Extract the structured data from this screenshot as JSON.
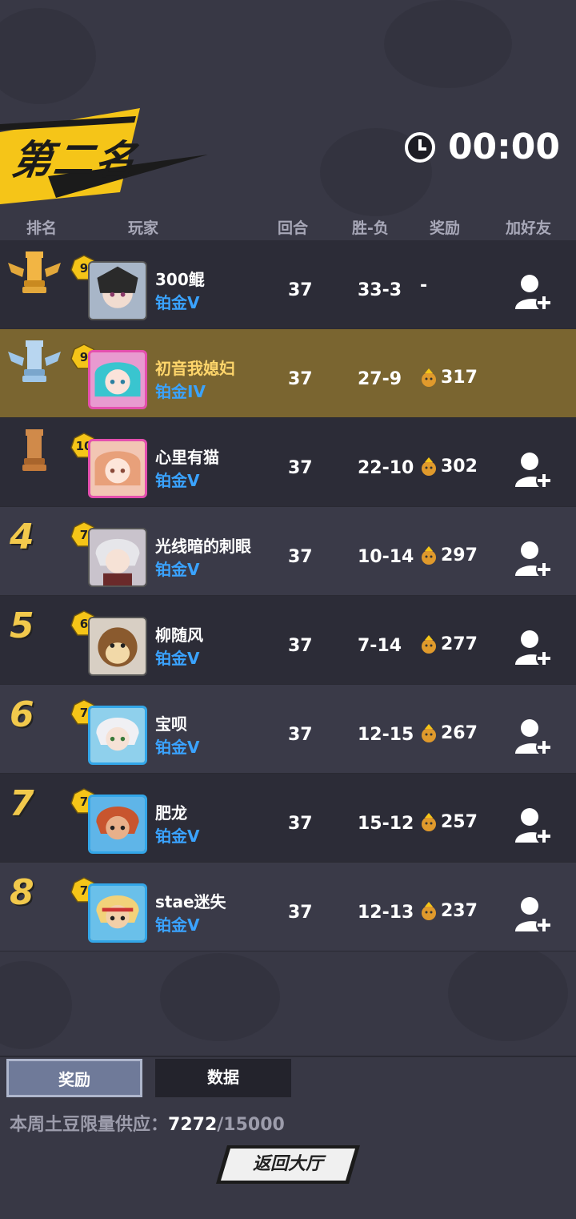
{
  "header": {
    "title": "第二名",
    "timer": "00:00",
    "colors": {
      "banner_yellow": "#f5c518",
      "self_row": "#7a6530",
      "tier_blue": "#3aa3ff"
    }
  },
  "columns": {
    "rank": "排名",
    "player": "玩家",
    "rounds": "回合",
    "win_loss": "胜-负",
    "reward": "奖励",
    "add_friend": "加好友"
  },
  "players": [
    {
      "rank": "1",
      "rank_icon": "gold-rook-icon",
      "level": "9",
      "name": "300鲲",
      "tier": "铂金V",
      "rounds": "37",
      "win_loss": "33-3",
      "reward": "-",
      "add_friend": true,
      "self": false
    },
    {
      "rank": "2",
      "rank_icon": "silver-rook-icon",
      "level": "9",
      "name": "初音我媳妇",
      "tier": "铂金IV",
      "rounds": "37",
      "win_loss": "27-9",
      "reward": "317",
      "add_friend": false,
      "self": true
    },
    {
      "rank": "3",
      "rank_icon": "bronze-rook-icon",
      "level": "10",
      "name": "心里有猫",
      "tier": "铂金V",
      "rounds": "37",
      "win_loss": "22-10",
      "reward": "302",
      "add_friend": true,
      "self": false
    },
    {
      "rank": "4",
      "level": "7",
      "name": "光线暗的刺眼",
      "tier": "铂金V",
      "rounds": "37",
      "win_loss": "10-14",
      "reward": "297",
      "add_friend": true,
      "self": false
    },
    {
      "rank": "5",
      "level": "6",
      "name": "柳随风",
      "tier": "铂金V",
      "rounds": "37",
      "win_loss": "7-14",
      "reward": "277",
      "add_friend": true,
      "self": false
    },
    {
      "rank": "6",
      "level": "7",
      "name": "宝呗",
      "tier": "铂金V",
      "rounds": "37",
      "win_loss": "12-15",
      "reward": "267",
      "add_friend": true,
      "self": false
    },
    {
      "rank": "7",
      "level": "7",
      "name": "肥龙",
      "tier": "铂金V",
      "rounds": "37",
      "win_loss": "15-12",
      "reward": "257",
      "add_friend": true,
      "self": false
    },
    {
      "rank": "8",
      "level": "7",
      "name": "stae迷失",
      "tier": "铂金V",
      "rounds": "37",
      "win_loss": "12-13",
      "reward": "237",
      "add_friend": true,
      "self": false
    }
  ],
  "tabs": {
    "rewards": "奖励",
    "data": "数据"
  },
  "supply": {
    "label": "本周土豆限量供应：",
    "current": "7272",
    "max": "/15000"
  },
  "back_button": "返回大厅"
}
